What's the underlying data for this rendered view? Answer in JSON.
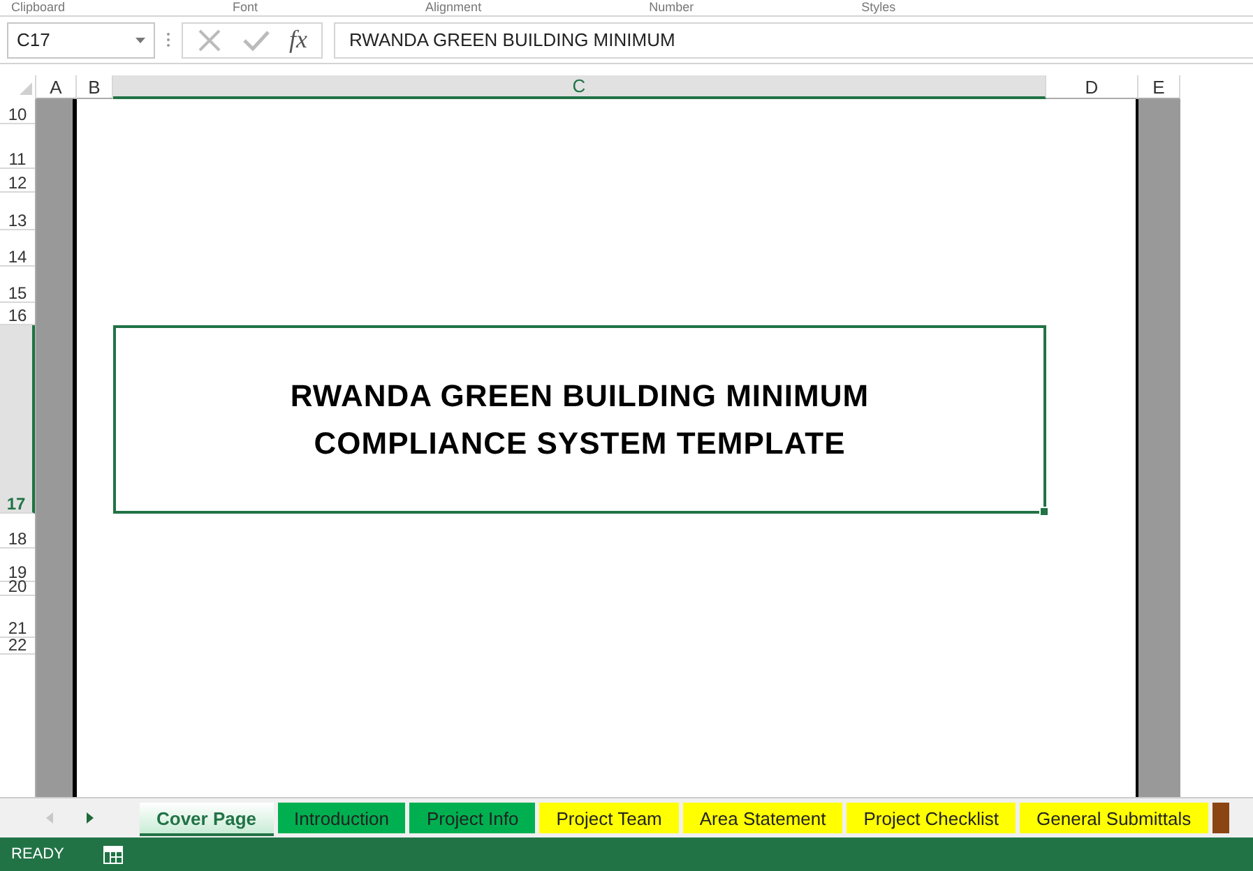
{
  "ribbon_groups": [
    "Clipboard",
    "Font",
    "Alignment",
    "Number",
    "Styles"
  ],
  "formula_bar": {
    "name_box": "C17",
    "fx_label": "fx",
    "value": "RWANDA GREEN BUILDING MINIMUM"
  },
  "columns": [
    {
      "label": "A",
      "selected": false
    },
    {
      "label": "B",
      "selected": false
    },
    {
      "label": "C",
      "selected": true
    },
    {
      "label": "D",
      "selected": false
    },
    {
      "label": "E",
      "selected": false
    }
  ],
  "rows": [
    {
      "label": "10",
      "selected": false
    },
    {
      "label": "11",
      "selected": false
    },
    {
      "label": "12",
      "selected": false
    },
    {
      "label": "13",
      "selected": false
    },
    {
      "label": "14",
      "selected": false
    },
    {
      "label": "15",
      "selected": false
    },
    {
      "label": "16",
      "selected": false
    },
    {
      "label": "17",
      "selected": true
    },
    {
      "label": "18",
      "selected": false
    },
    {
      "label": "19",
      "selected": false
    },
    {
      "label": "20",
      "selected": false
    },
    {
      "label": "21",
      "selected": false
    },
    {
      "label": "22",
      "selected": false
    }
  ],
  "title_cell": {
    "lines": [
      "RWANDA GREEN BUILDING MINIMUM",
      "COMPLIANCE SYSTEM TEMPLATE"
    ]
  },
  "sheet_tabs": [
    {
      "label": "Cover Page",
      "selected": true
    },
    {
      "label": "Introduction",
      "selected": false,
      "color": "#00b050"
    },
    {
      "label": "Project Info",
      "selected": false,
      "color": "#00b050"
    },
    {
      "label": "Project Team",
      "selected": false,
      "color": "#ffff00"
    },
    {
      "label": "Area Statement",
      "selected": false,
      "color": "#ffff00"
    },
    {
      "label": "Project Checklist",
      "selected": false,
      "color": "#ffff00"
    },
    {
      "label": "General Submittals",
      "selected": false,
      "color": "#ffff00"
    },
    {
      "selected": false,
      "color": "#8b4513"
    }
  ],
  "status_bar": {
    "mode": "READY"
  }
}
